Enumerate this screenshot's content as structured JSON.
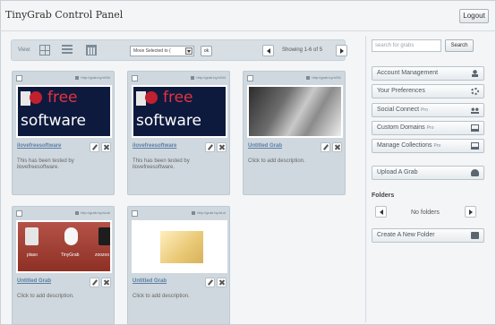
{
  "app": {
    "title": "TinyGrab Control Panel",
    "logout_label": "Logout"
  },
  "toolbar": {
    "view_label": "View:",
    "view_icons": [
      "grid-view-icon",
      "list-view-icon",
      "calendar-view-icon"
    ],
    "move_select_value": "Move Selected to (",
    "ok_label": "ok",
    "showing_text": "Showing 1-6 of 5"
  },
  "grabs": [
    {
      "link": "http://grab.by/nSt4",
      "title": "ilovefreesoftware",
      "description": "This has been tested by ilovefreesoftware.",
      "thumb_top": "free",
      "thumb_bottom": "software"
    },
    {
      "link": "http://grab.by/nSt4",
      "title": "ilovefreesoftware",
      "description": "This has been tested by ilovefreesoftware.",
      "thumb_top": "free",
      "thumb_bottom": "software"
    },
    {
      "link": "http://grab.by/nSt1",
      "title": "Untitled Grab",
      "description": "Click to add description."
    },
    {
      "link": "http://grab.by/aLsk",
      "title": "Untitled Grab",
      "description": "Click to add description.",
      "desktop_labels": [
        "plaso",
        "TinyGrab",
        "zoozoo"
      ]
    },
    {
      "link": "http://grab.by/aLsl",
      "title": "Untitled Grab",
      "description": "Click to add description."
    }
  ],
  "sidebar": {
    "search_placeholder": "search for grabs",
    "search_button": "Search",
    "items": [
      {
        "label": "Account Management",
        "pro": "",
        "icon": "user-icon"
      },
      {
        "label": "Your Preferences",
        "pro": "",
        "icon": "gear-icon"
      },
      {
        "label": "Social Connect",
        "pro": "Pro",
        "icon": "people-icon"
      },
      {
        "label": "Custom Domains",
        "pro": "Pro",
        "icon": "monitor-icon"
      },
      {
        "label": "Manage Collections",
        "pro": "Pro",
        "icon": "monitor-icon"
      }
    ],
    "upload_label": "Upload A Grab",
    "folders_label": "Folders",
    "no_folders": "No folders",
    "create_folder": "Create A New Folder"
  }
}
